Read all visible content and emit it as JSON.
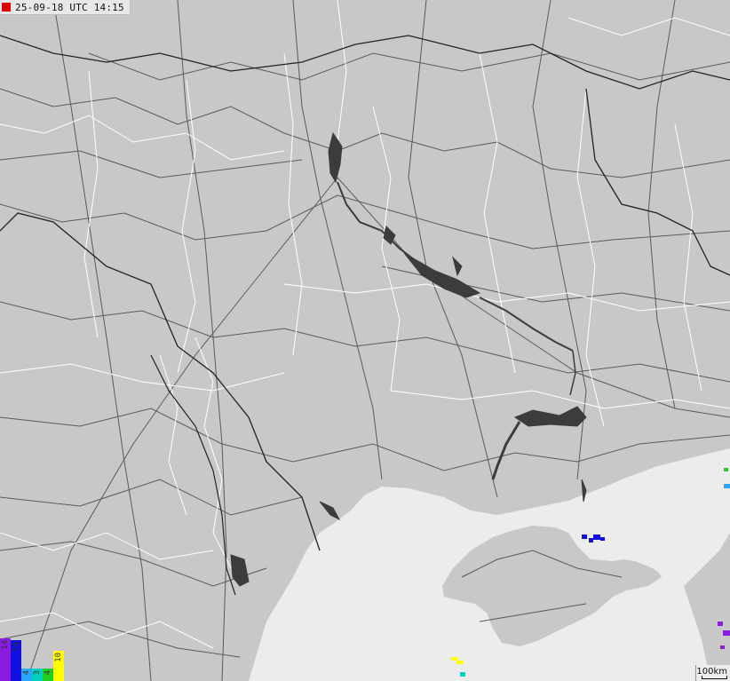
{
  "header": {
    "timestamp": "25-09-18 UTC 14:15",
    "live_color": "#e00000"
  },
  "legend": {
    "bars": [
      {
        "label": "14",
        "color": "#8a1be0"
      },
      {
        "label": "14",
        "color": "#1010e0"
      },
      {
        "label": "4",
        "color": "#2aa8ff"
      },
      {
        "label": "3",
        "color": "#00d0c0"
      },
      {
        "label": "4",
        "color": "#20d020"
      },
      {
        "label": "10",
        "color": "#ffff00"
      }
    ]
  },
  "scale": {
    "label": "100km"
  },
  "colors": {
    "land": "#c8c8c8",
    "sea": "#ececec",
    "water": "#3c3c3c",
    "roads": "#5a5a5a",
    "borders": "#ffffff"
  }
}
